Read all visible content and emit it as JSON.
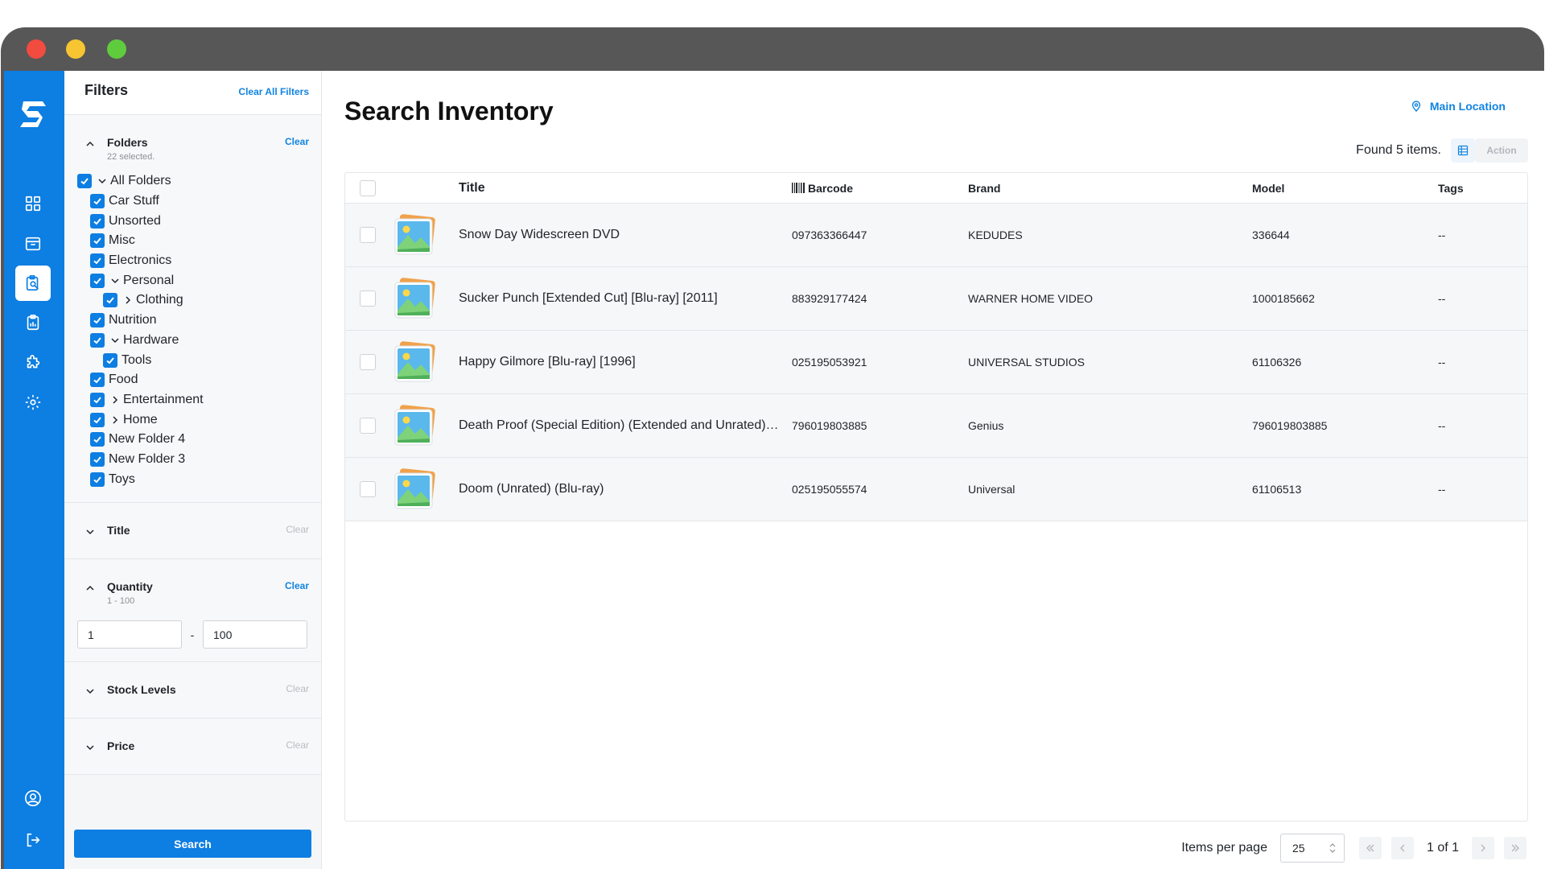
{
  "window": {
    "title": ""
  },
  "rail": {
    "items": [
      {
        "icon": "dashboard-icon",
        "active": false
      },
      {
        "icon": "inventory-box-icon",
        "active": false
      },
      {
        "icon": "search-clipboard-icon",
        "active": true
      },
      {
        "icon": "report-clipboard-icon",
        "active": false
      },
      {
        "icon": "integrations-puzzle-icon",
        "active": false
      },
      {
        "icon": "settings-gear-icon",
        "active": false
      }
    ],
    "bottom": [
      {
        "icon": "user-profile-icon"
      },
      {
        "icon": "logout-icon"
      }
    ]
  },
  "filters": {
    "title": "Filters",
    "clear_all": "Clear All Filters",
    "folders": {
      "name": "Folders",
      "sub": "22 selected.",
      "clear": "Clear",
      "tree": [
        {
          "label": "All Folders",
          "depth": 0,
          "expander": "open"
        },
        {
          "label": "Car Stuff",
          "depth": 1,
          "expander": "none"
        },
        {
          "label": "Unsorted",
          "depth": 1,
          "expander": "none"
        },
        {
          "label": "Misc",
          "depth": 1,
          "expander": "none"
        },
        {
          "label": "Electronics",
          "depth": 1,
          "expander": "none"
        },
        {
          "label": "Personal",
          "depth": 1,
          "expander": "open"
        },
        {
          "label": "Clothing",
          "depth": 2,
          "expander": "closed"
        },
        {
          "label": "Nutrition",
          "depth": 1,
          "expander": "none"
        },
        {
          "label": "Hardware",
          "depth": 1,
          "expander": "open"
        },
        {
          "label": "Tools",
          "depth": 2,
          "expander": "none"
        },
        {
          "label": "Food",
          "depth": 1,
          "expander": "none"
        },
        {
          "label": "Entertainment",
          "depth": 1,
          "expander": "closed"
        },
        {
          "label": "Home",
          "depth": 1,
          "expander": "closed"
        },
        {
          "label": "New Folder 4",
          "depth": 1,
          "expander": "none"
        },
        {
          "label": "New Folder 3",
          "depth": 1,
          "expander": "none"
        },
        {
          "label": "Toys",
          "depth": 1,
          "expander": "none"
        }
      ]
    },
    "title_filter": {
      "name": "Title",
      "clear": "Clear"
    },
    "quantity": {
      "name": "Quantity",
      "sub": "1 - 100",
      "clear": "Clear",
      "min": "1",
      "max": "100",
      "dash": "-"
    },
    "stock_levels": {
      "name": "Stock Levels",
      "clear": "Clear"
    },
    "price": {
      "name": "Price",
      "clear": "Clear"
    },
    "search_label": "Search"
  },
  "main": {
    "title": "Search Inventory",
    "location": "Main Location",
    "found": "Found 5 items.",
    "action": "Action",
    "columns": {
      "title": "Title",
      "barcode": "Barcode",
      "brand": "Brand",
      "model": "Model",
      "tags": "Tags"
    },
    "rows": [
      {
        "title": "Snow Day Widescreen DVD",
        "barcode": "097363366447",
        "brand": "KEDUDES",
        "model": "336644",
        "tags": "--"
      },
      {
        "title": "Sucker Punch [Extended Cut] [Blu-ray] [2011]",
        "barcode": "883929177424",
        "brand": "WARNER HOME VIDEO",
        "model": "1000185662",
        "tags": "--"
      },
      {
        "title": "Happy Gilmore [Blu-ray] [1996]",
        "barcode": "025195053921",
        "brand": "UNIVERSAL STUDIOS",
        "model": "61106326",
        "tags": "--"
      },
      {
        "title": "Death Proof (Special Edition) (Extended and Unrated) (Blu-ray)",
        "barcode": "796019803885",
        "brand": "Genius",
        "model": "796019803885",
        "tags": "--"
      },
      {
        "title": "Doom (Unrated) (Blu-ray)",
        "barcode": "025195055574",
        "brand": "Universal",
        "model": "61106513",
        "tags": "--"
      }
    ],
    "pager": {
      "label": "Items per page",
      "per_page": "25",
      "page": "1 of 1"
    }
  },
  "colors": {
    "accent": "#0d7ee2",
    "link": "#1184e0",
    "muted": "#b9bcc1"
  }
}
